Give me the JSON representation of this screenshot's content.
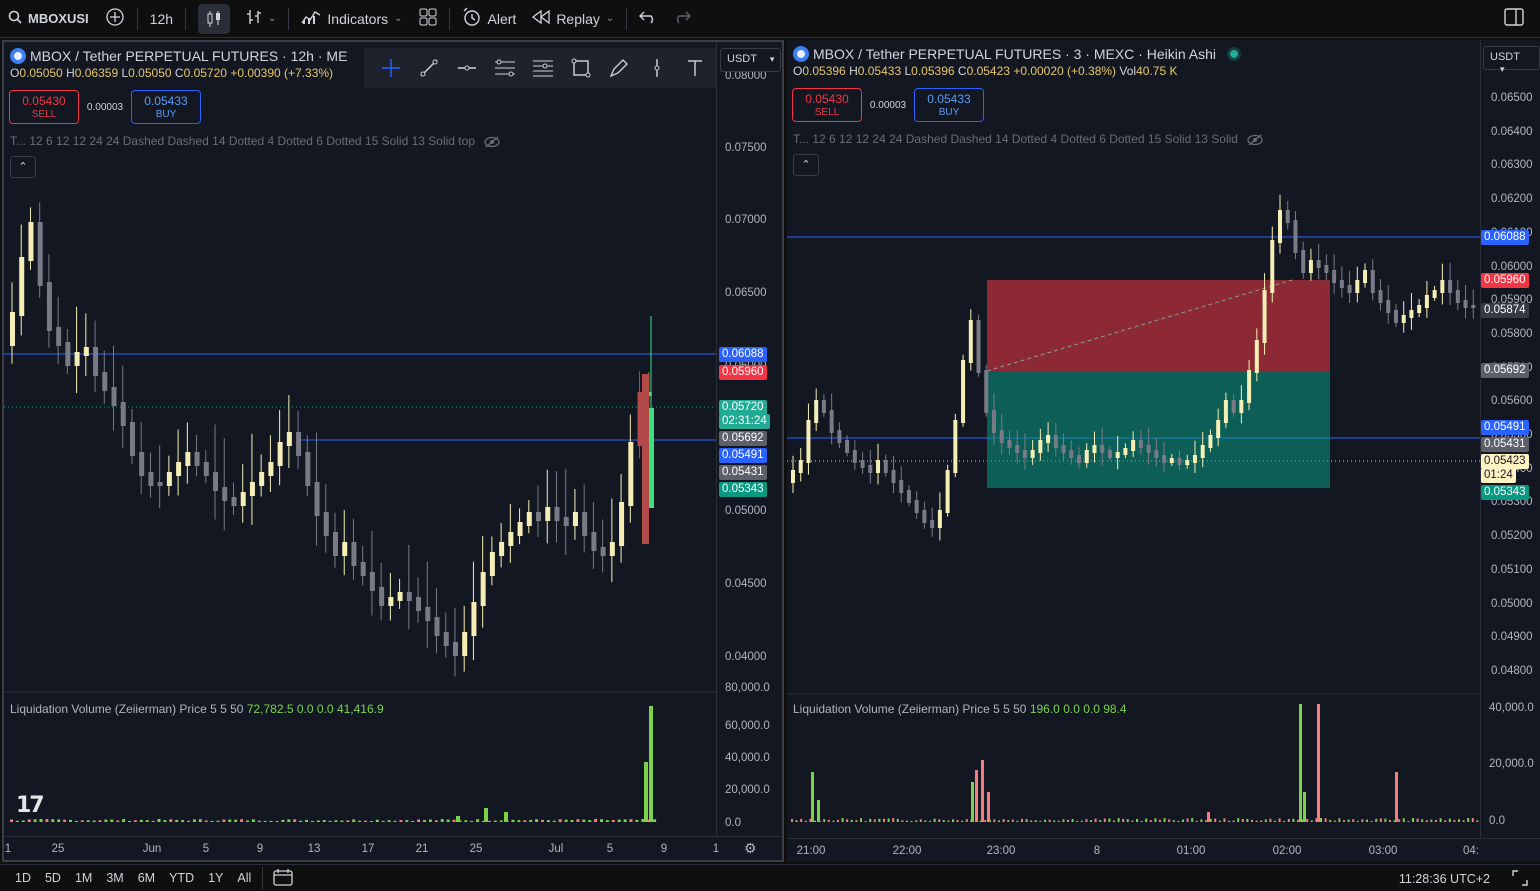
{
  "toolbar": {
    "symbol": "MBOXUSI",
    "interval": "12h",
    "indicators_label": "Indicators",
    "alert_label": "Alert",
    "replay_label": "Replay"
  },
  "left_chart": {
    "title": "MBOX / Tether PERPETUAL FUTURES · 12h · ME",
    "ohlc": {
      "o": "0.05050",
      "h": "0.06359",
      "l": "0.05050",
      "c": "0.05720",
      "chg": "+0.00390 (+7.33%)"
    },
    "sell_price": "0.05430",
    "sell_label": "SELL",
    "buy_price": "0.05433",
    "buy_label": "BUY",
    "spread": "0.00003",
    "indicator_line": "T... 12 6 12 12 24 24 Dashed Dashed 14 Dotted 4 Dotted 6 Dotted 15 Solid 13 Solid top",
    "currency": "USDT",
    "price_ticks": [
      "0.08000",
      "0.07500",
      "0.07000",
      "0.06500",
      "0.06000",
      "0.05500",
      "0.05000",
      "0.04500",
      "0.04000"
    ],
    "time_ticks": [
      "1",
      "25",
      "Jun",
      "5",
      "9",
      "13",
      "17",
      "21",
      "25",
      "Jul",
      "5",
      "9",
      "1"
    ],
    "tags": [
      {
        "text": "0.06088",
        "color": "#2962ff"
      },
      {
        "text": "0.05960",
        "color": "#f23645"
      },
      {
        "text": "0.05720",
        "color": "#22ab94"
      },
      {
        "text": "02:31:24",
        "color": "#22ab94"
      },
      {
        "text": "0.05692",
        "color": "#5d606b"
      },
      {
        "text": "0.05491",
        "color": "#2962ff"
      },
      {
        "text": "0.05431",
        "color": "#5d606b"
      },
      {
        "text": "0.05343",
        "color": "#089981"
      }
    ],
    "sub_legend": {
      "name": "Liquidation Volume (Zeiierman) Price 5 5 50",
      "v1": "72,782.5",
      "v2": "0.0",
      "v3": "0.0",
      "v4": "41,416.9"
    },
    "sub_ticks": [
      "80,000.0",
      "60,000.0",
      "40,000.0",
      "20,000.0",
      "0.0"
    ]
  },
  "right_chart": {
    "title": "MBOX / Tether PERPETUAL FUTURES · 3 · MEXC · Heikin Ashi",
    "ohlc": {
      "o": "0.05396",
      "h": "0.05433",
      "l": "0.05396",
      "c": "0.05423",
      "chg": "+0.00020 (+0.38%)",
      "vol": "40.75 K"
    },
    "sell_price": "0.05430",
    "sell_label": "SELL",
    "buy_price": "0.05433",
    "buy_label": "BUY",
    "spread": "0.00003",
    "indicator_line": "T... 12 6 12 12 24 24 Dashed Dashed 14 Dotted 4 Dotted 6 Dotted 15 Solid 13 Solid",
    "currency": "USDT",
    "price_ticks": [
      "0.06500",
      "0.06400",
      "0.06300",
      "0.06200",
      "0.06100",
      "0.06000",
      "0.05900",
      "0.05800",
      "0.05700",
      "0.05600",
      "0.05500",
      "0.05400",
      "0.05300",
      "0.05200",
      "0.05100",
      "0.05000",
      "0.04900",
      "0.04800"
    ],
    "time_ticks": [
      "21:00",
      "22:00",
      "23:00",
      "8",
      "01:00",
      "02:00",
      "03:00",
      "04:"
    ],
    "tags": [
      {
        "text": "0.06088",
        "color": "#2962ff"
      },
      {
        "text": "0.05960",
        "color": "#f23645"
      },
      {
        "text": "0.05874",
        "color": "#363a45"
      },
      {
        "text": "0.05692",
        "color": "#5d606b"
      },
      {
        "text": "0.05491",
        "color": "#2962ff"
      },
      {
        "text": "0.05431",
        "color": "#5d606b"
      },
      {
        "text": "0.05423",
        "color": "#fff3c4"
      },
      {
        "text": "01:24",
        "color": "#fff3c4"
      },
      {
        "text": "0.05343",
        "color": "#089981"
      }
    ],
    "sub_legend": {
      "name": "Liquidation Volume (Zeiierman) Price 5 5 50",
      "v1": "196.0",
      "v2": "0.0",
      "v3": "0.0",
      "v4": "98.4"
    },
    "sub_ticks": [
      "40,000.0",
      "20,000.0",
      "0.0"
    ]
  },
  "ranges": [
    "1D",
    "5D",
    "1M",
    "3M",
    "6M",
    "YTD",
    "1Y",
    "All"
  ],
  "clock": "11:28:36 UTC+2",
  "colors": {
    "up": "#f5efb5",
    "down": "#787b86",
    "accent": "#2962ff",
    "sell": "#f23645"
  }
}
